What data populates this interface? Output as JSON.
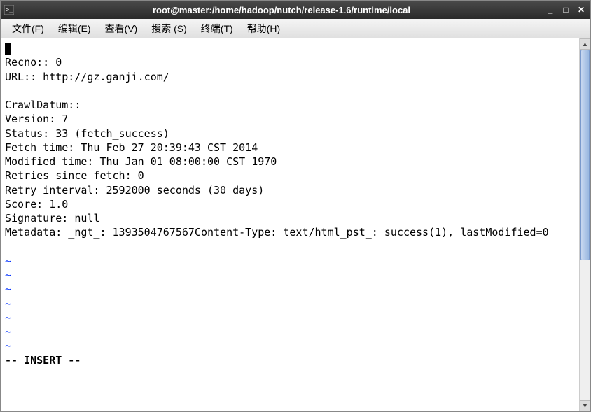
{
  "titlebar": {
    "title": "root@master:/home/hadoop/nutch/release-1.6/runtime/local"
  },
  "menubar": {
    "items": [
      "文件(F)",
      "编辑(E)",
      "查看(V)",
      "搜索 (S)",
      "终端(T)",
      "帮助(H)"
    ]
  },
  "terminal": {
    "lines": [
      "Recno:: 0",
      "URL:: http://gz.ganji.com/",
      "",
      "CrawlDatum::",
      "Version: 7",
      "Status: 33 (fetch_success)",
      "Fetch time: Thu Feb 27 20:39:43 CST 2014",
      "Modified time: Thu Jan 01 08:00:00 CST 1970",
      "Retries since fetch: 0",
      "Retry interval: 2592000 seconds (30 days)",
      "Score: 1.0",
      "Signature: null",
      "Metadata: _ngt_: 1393504767567Content-Type: text/html_pst_: success(1), lastModified=0"
    ],
    "tilde_count": 7,
    "tilde": "~",
    "status": "-- INSERT --"
  }
}
